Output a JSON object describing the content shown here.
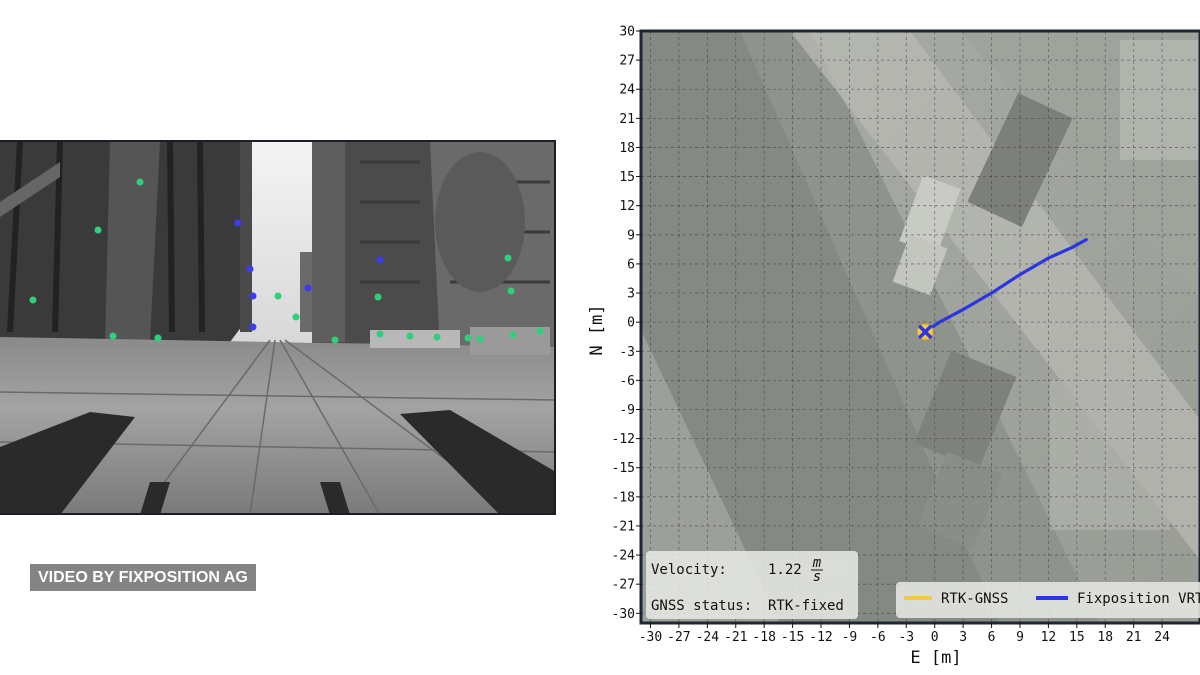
{
  "credit": {
    "text": "VIDEO BY FIXPOSITION AG"
  },
  "camera": {
    "feature_colors": {
      "green": "#2fd07a",
      "blue": "#3a3df0"
    }
  },
  "map": {
    "info": {
      "velocity_label": "Velocity:",
      "velocity_value": "1.22",
      "velocity_unit_num": "m",
      "velocity_unit_den": "s",
      "gnss_label": "GNSS status:",
      "gnss_value": "RTK-fixed"
    },
    "legend": [
      {
        "name": "RTK-GNSS",
        "color": "#f2c94c"
      },
      {
        "name": "Fixposition VRTK",
        "color": "#2b35e0"
      }
    ]
  },
  "chart_data": {
    "type": "line",
    "xlabel": "E [m]",
    "ylabel": "N [m]",
    "xlim": [
      -31,
      28
    ],
    "ylim": [
      -31,
      30
    ],
    "xticks": [
      -30,
      -27,
      -24,
      -21,
      -18,
      -15,
      -12,
      -9,
      -6,
      -3,
      0,
      3,
      6,
      9,
      12,
      15,
      18,
      21,
      24
    ],
    "yticks": [
      30,
      27,
      24,
      21,
      18,
      15,
      12,
      9,
      6,
      3,
      0,
      -3,
      -6,
      -9,
      -12,
      -15,
      -18,
      -21,
      -24,
      -27,
      -30
    ],
    "grid": true,
    "series": [
      {
        "name": "RTK-GNSS",
        "color": "#f2c94c",
        "x": [
          -1.0
        ],
        "y": [
          -1.0
        ]
      },
      {
        "name": "Fixposition VRTK",
        "color": "#2b35e0",
        "x": [
          -1.0,
          0.5,
          3.0,
          6.0,
          9.0,
          12.0,
          14.5,
          16.0
        ],
        "y": [
          -1.0,
          0.0,
          1.3,
          3.0,
          4.9,
          6.6,
          7.7,
          8.5
        ]
      }
    ],
    "current_position": {
      "x": -1.0,
      "y": -1.0
    },
    "legend_position": "bottom-right"
  }
}
